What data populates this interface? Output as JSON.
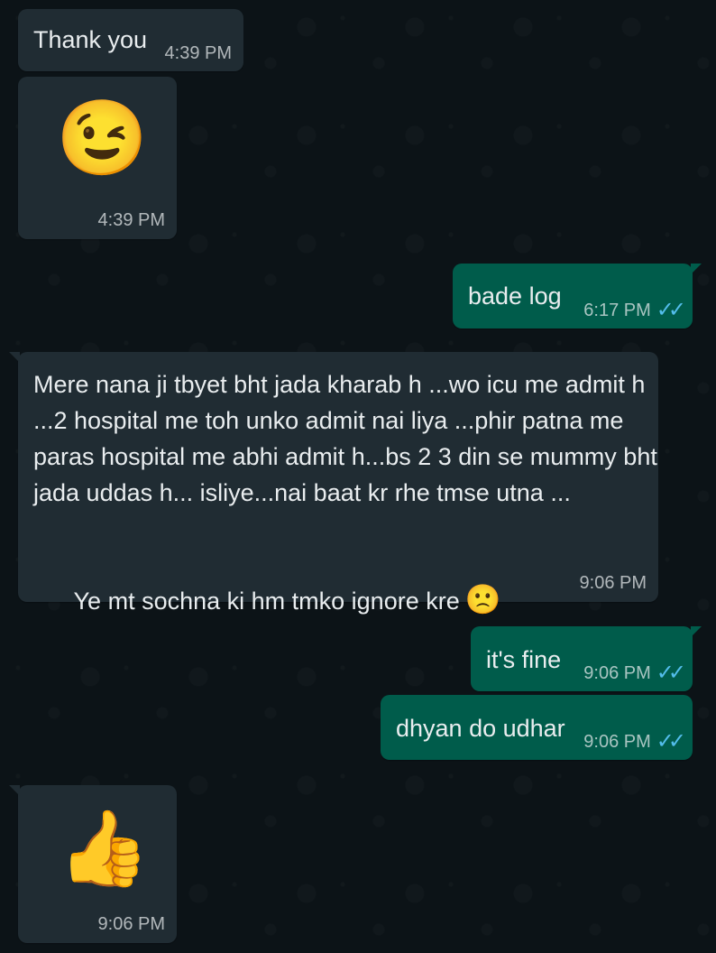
{
  "messages": [
    {
      "sender": "incoming",
      "type": "text",
      "text": "Thank you",
      "time": "4:39 PM"
    },
    {
      "sender": "incoming",
      "type": "emoji",
      "emoji": "😉",
      "emoji_name": "winking-face-emoji",
      "time": "4:39 PM"
    },
    {
      "sender": "outgoing",
      "type": "text",
      "text": "bade log",
      "time": "6:17 PM",
      "status": "read",
      "status_icon": "double-check-icon"
    },
    {
      "sender": "incoming",
      "type": "text",
      "lines": [
        "Mere nana ji tbyet bht jada kharab h ...wo icu me admit h",
        "...2 hospital me toh unko admit nai liya ...phir patna me",
        "paras hospital me abhi admit h...bs 2 3 din se mummy bht",
        "jada uddas h... isliye...nai baat kr rhe tmse utna ...",
        "",
        "Ye mt sochna ki hm tmko ignore kre"
      ],
      "trailing_emoji": "🙁",
      "trailing_emoji_name": "slightly-frowning-face-emoji",
      "time": "9:06 PM"
    },
    {
      "sender": "outgoing",
      "type": "text",
      "text": "it's fine",
      "time": "9:06 PM",
      "status": "read",
      "status_icon": "double-check-icon"
    },
    {
      "sender": "outgoing",
      "type": "text",
      "text": "dhyan do udhar",
      "time": "9:06 PM",
      "status": "read",
      "status_icon": "double-check-icon"
    },
    {
      "sender": "incoming",
      "type": "emoji",
      "emoji": "👍",
      "emoji_name": "thumbs-up-emoji",
      "time": "9:06 PM"
    }
  ],
  "colors": {
    "background": "#0c1317",
    "incoming_bubble": "#202c33",
    "outgoing_bubble": "#005c4b",
    "read_tick": "#53bdeb",
    "text": "#e9edef"
  },
  "tick_glyph": "✓✓"
}
